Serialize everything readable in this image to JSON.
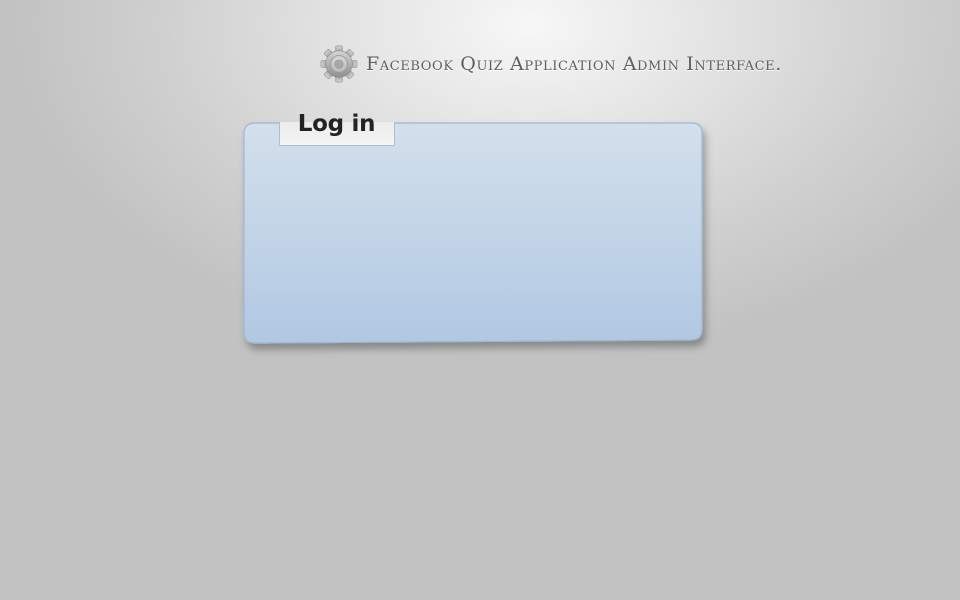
{
  "header": {
    "icon": "gear-icon",
    "title": "Facebook Quiz Application Admin Interface."
  },
  "login_panel": {
    "tab_label": "Log in"
  },
  "colors": {
    "panel_top": "#d3e0ec",
    "panel_bottom": "#b1c8e2",
    "panel_border": "#9db7d2",
    "tab_background": "#efefef",
    "background_light": "#f7f7f7",
    "background_dark": "#c2c2c2"
  }
}
